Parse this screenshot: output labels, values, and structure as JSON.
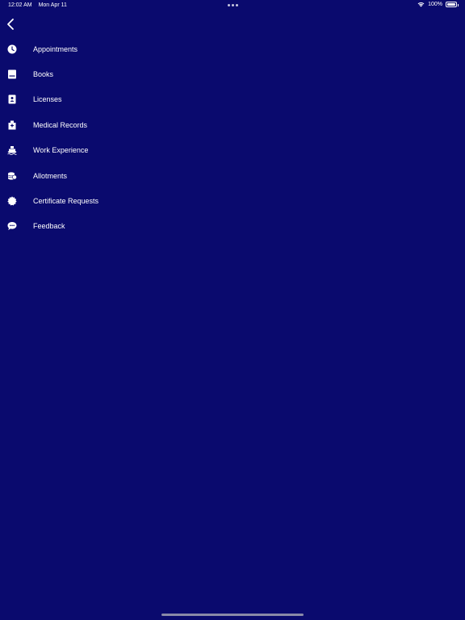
{
  "status_bar": {
    "time": "12:02 AM",
    "date": "Mon Apr 11",
    "battery": "100%"
  },
  "navigation": {
    "back_icon": "chevron-left-icon"
  },
  "menu": {
    "items": [
      {
        "label": "Appointments",
        "icon": "clock-icon"
      },
      {
        "label": "Books",
        "icon": "book-icon"
      },
      {
        "label": "Licenses",
        "icon": "id-badge-icon"
      },
      {
        "label": "Medical Records",
        "icon": "hospital-icon"
      },
      {
        "label": "Work Experience",
        "icon": "ship-icon"
      },
      {
        "label": "Allotments",
        "icon": "coins-icon"
      },
      {
        "label": "Certificate Requests",
        "icon": "certificate-icon"
      },
      {
        "label": "Feedback",
        "icon": "chat-bubble-icon"
      }
    ]
  },
  "colors": {
    "background": "#0a0a6e",
    "text": "#ffffff"
  }
}
